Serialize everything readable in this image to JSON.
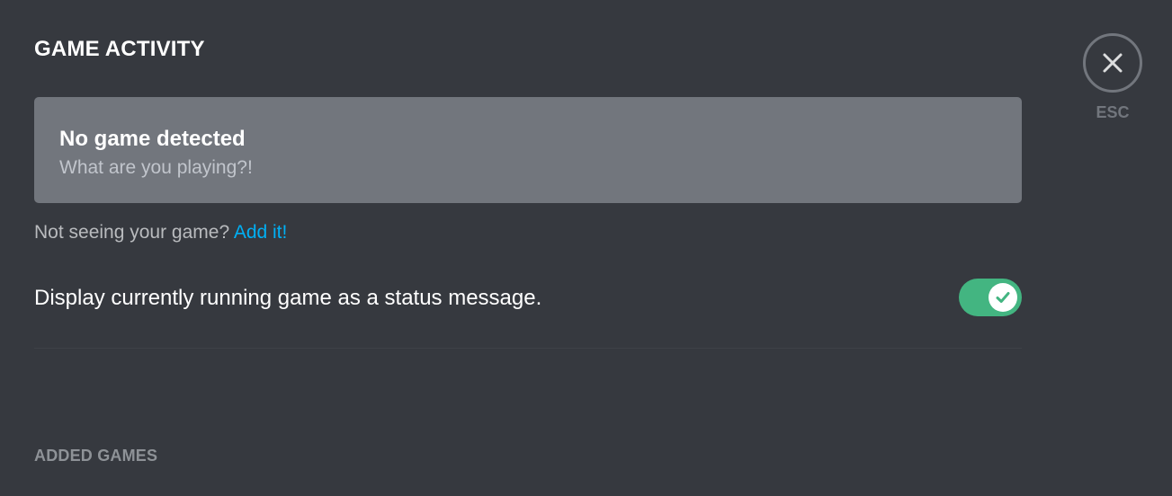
{
  "page": {
    "title": "GAME ACTIVITY"
  },
  "game_status": {
    "title": "No game detected",
    "subtitle": "What are you playing?!"
  },
  "add_game": {
    "prompt": "Not seeing your game? ",
    "link_label": "Add it!"
  },
  "status_setting": {
    "label": "Display currently running game as a status message.",
    "enabled": true
  },
  "added_games": {
    "title": "ADDED GAMES"
  },
  "close": {
    "label": "ESC",
    "icon": "close-icon"
  },
  "colors": {
    "background": "#36393f",
    "panel": "#72767d",
    "link": "#00b0f4",
    "toggle_on": "#43b581"
  }
}
